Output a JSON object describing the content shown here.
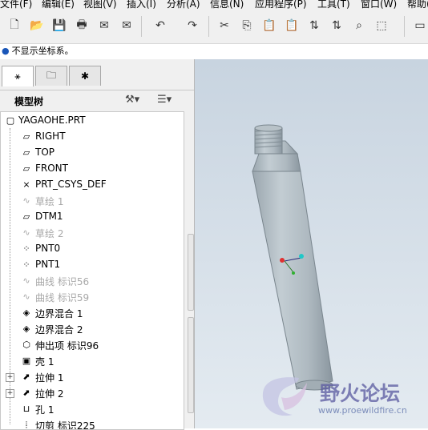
{
  "menu": [
    "文件(F)",
    "编辑(E)",
    "视图(V)",
    "插入(I)",
    "分析(A)",
    "信息(N)",
    "应用程序(P)",
    "工具(T)",
    "窗口(W)",
    "帮助("
  ],
  "toolbar": {
    "icons": [
      "new-file-icon",
      "open-folder-icon",
      "save-icon",
      "print-icon",
      "send-mail-icon",
      "mail-attach-icon",
      "undo-icon",
      "redo-icon",
      "cut-icon",
      "copy-icon",
      "paste-icon",
      "paste-special-icon",
      "regenerate-icon",
      "regen-manager-icon",
      "find-icon",
      "select-box-icon",
      "window-icon"
    ],
    "glyphs": [
      "🗋",
      "📂",
      "💾",
      "🖶",
      "✉",
      "✉",
      "↶",
      "↷",
      "✂",
      "⎘",
      "📋",
      "📋",
      "⇅",
      "⇅",
      "⌕",
      "⬚",
      "▭"
    ]
  },
  "message": "不显示坐标系。",
  "panel": {
    "tabs": [
      "model-tree-tab",
      "folder-browser-tab",
      "favorites-tab"
    ],
    "title": "模型树"
  },
  "tree": {
    "root": "YAGAOHE.PRT",
    "items": [
      {
        "label": "RIGHT",
        "icon": "datum-plane-icon",
        "glyph": "▱",
        "grey": false,
        "exp": false
      },
      {
        "label": "TOP",
        "icon": "datum-plane-icon",
        "glyph": "▱",
        "grey": false,
        "exp": false
      },
      {
        "label": "FRONT",
        "icon": "datum-plane-icon",
        "glyph": "▱",
        "grey": false,
        "exp": false
      },
      {
        "label": "PRT_CSYS_DEF",
        "icon": "coordinate-system-icon",
        "glyph": "⨯",
        "grey": false,
        "exp": false
      },
      {
        "label": "草绘 1",
        "icon": "sketch-icon",
        "glyph": "∿",
        "grey": true,
        "exp": false
      },
      {
        "label": "DTM1",
        "icon": "datum-plane-icon",
        "glyph": "▱",
        "grey": false,
        "exp": false
      },
      {
        "label": "草绘 2",
        "icon": "sketch-icon",
        "glyph": "∿",
        "grey": true,
        "exp": false
      },
      {
        "label": "PNT0",
        "icon": "datum-point-icon",
        "glyph": "⁘",
        "grey": false,
        "exp": false
      },
      {
        "label": "PNT1",
        "icon": "datum-point-icon",
        "glyph": "⁘",
        "grey": false,
        "exp": false
      },
      {
        "label": "曲线 标识56",
        "icon": "curve-icon",
        "glyph": "∿",
        "grey": true,
        "exp": false
      },
      {
        "label": "曲线 标识59",
        "icon": "curve-icon",
        "glyph": "∿",
        "grey": true,
        "exp": false
      },
      {
        "label": "边界混合 1",
        "icon": "boundary-blend-icon",
        "glyph": "◈",
        "grey": false,
        "exp": false
      },
      {
        "label": "边界混合 2",
        "icon": "boundary-blend-icon",
        "glyph": "◈",
        "grey": false,
        "exp": false
      },
      {
        "label": "伸出项 标识96",
        "icon": "protrusion-icon",
        "glyph": "⬡",
        "grey": false,
        "exp": false
      },
      {
        "label": "壳 1",
        "icon": "shell-icon",
        "glyph": "▣",
        "grey": false,
        "exp": false
      },
      {
        "label": "拉伸 1",
        "icon": "extrude-icon",
        "glyph": "⬈",
        "grey": false,
        "exp": true
      },
      {
        "label": "拉伸 2",
        "icon": "extrude-icon",
        "glyph": "⬈",
        "grey": false,
        "exp": true
      },
      {
        "label": "孔 1",
        "icon": "hole-icon",
        "glyph": "⊔",
        "grey": false,
        "exp": false
      },
      {
        "label": "切剪 标识225",
        "icon": "cut-icon",
        "glyph": "⦙",
        "grey": false,
        "exp": false
      }
    ]
  },
  "watermark": {
    "title": "野火论坛",
    "url": "www.proewildfire.cn"
  }
}
